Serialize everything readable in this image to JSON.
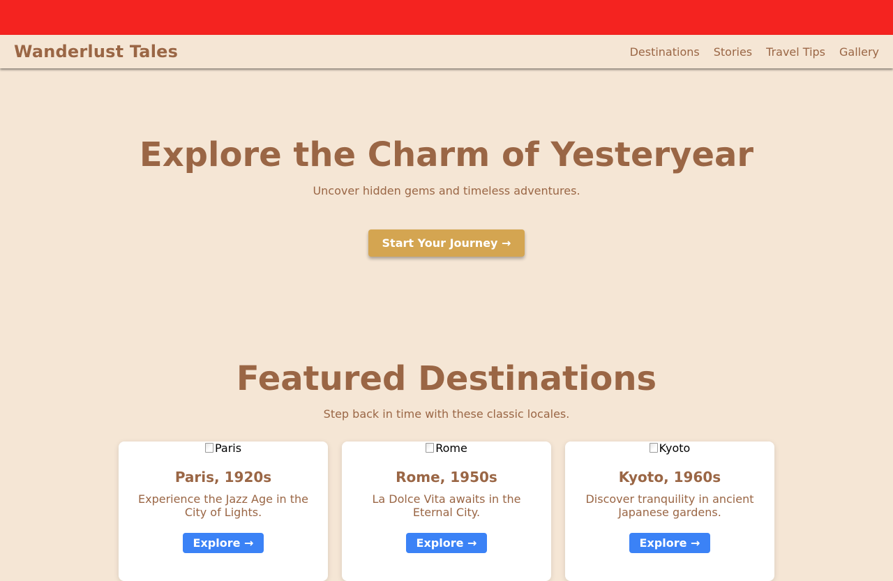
{
  "nav": {
    "brand": "Wanderlust Tales",
    "links": [
      "Destinations",
      "Stories",
      "Travel Tips",
      "Gallery"
    ]
  },
  "hero": {
    "title": "Explore the Charm of Yesteryear",
    "subtitle": "Uncover hidden gems and timeless adventures.",
    "cta_label": "Start Your Journey →"
  },
  "featured": {
    "title": "Featured Destinations",
    "subtitle": "Step back in time with these classic locales.",
    "cards": [
      {
        "img_alt": "Paris",
        "title": "Paris, 1920s",
        "desc": "Experience the Jazz Age in the City of Lights.",
        "button": "Explore →"
      },
      {
        "img_alt": "Rome",
        "title": "Rome, 1950s",
        "desc": "La Dolce Vita awaits in the Eternal City.",
        "button": "Explore →"
      },
      {
        "img_alt": "Kyoto",
        "title": "Kyoto, 1960s",
        "desc": "Discover tranquility in ancient Japanese gardens.",
        "button": "Explore →"
      }
    ]
  },
  "colors": {
    "top_bar": "#f42320",
    "background": "#f5e6d5",
    "text": "#9a6645",
    "cta": "#d4a551",
    "card_button": "#3b82f6"
  }
}
